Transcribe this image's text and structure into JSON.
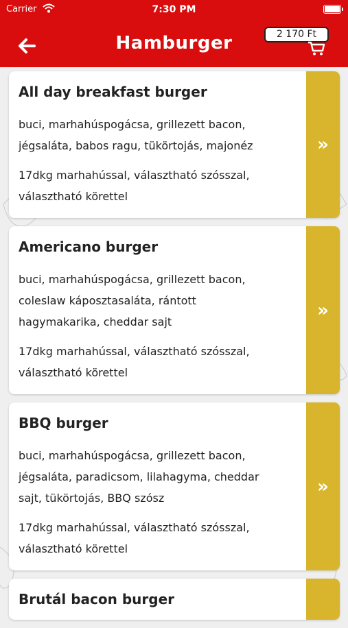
{
  "status_bar": {
    "carrier": "Carrier",
    "time": "7:30 PM"
  },
  "header": {
    "title": "Hamburger",
    "cart_total": "2 170 Ft",
    "back_icon": "arrow-left-icon",
    "cart_icon": "shopping-cart-icon"
  },
  "colors": {
    "header_bg": "#d90d0d",
    "accent": "#d8b52c",
    "background": "#efefef"
  },
  "items": [
    {
      "name": "All day breakfast burger",
      "ingredients": "buci, marhahúspogácsa, grillezett bacon, jégsaláta, babos ragu, tükörtojás, majonéz",
      "details": "17dkg marhahússal, választható szósszal, választható körettel"
    },
    {
      "name": "Americano burger",
      "ingredients": "buci, marhahúspogácsa, grillezett bacon, coleslaw káposztasaláta, rántott hagymakarika, cheddar sajt",
      "details": "17dkg marhahússal, választható szósszal, választható körettel"
    },
    {
      "name": "BBQ burger",
      "ingredients": "buci, marhahúspogácsa, grillezett bacon, jégsaláta, paradicsom, lilahagyma, cheddar sajt, tükörtojás, BBQ szósz",
      "details": "17dkg marhahússal, választható szósszal, választható körettel"
    },
    {
      "name": "Brutál bacon burger",
      "ingredients": "",
      "details": ""
    }
  ],
  "item_action_label": "»"
}
